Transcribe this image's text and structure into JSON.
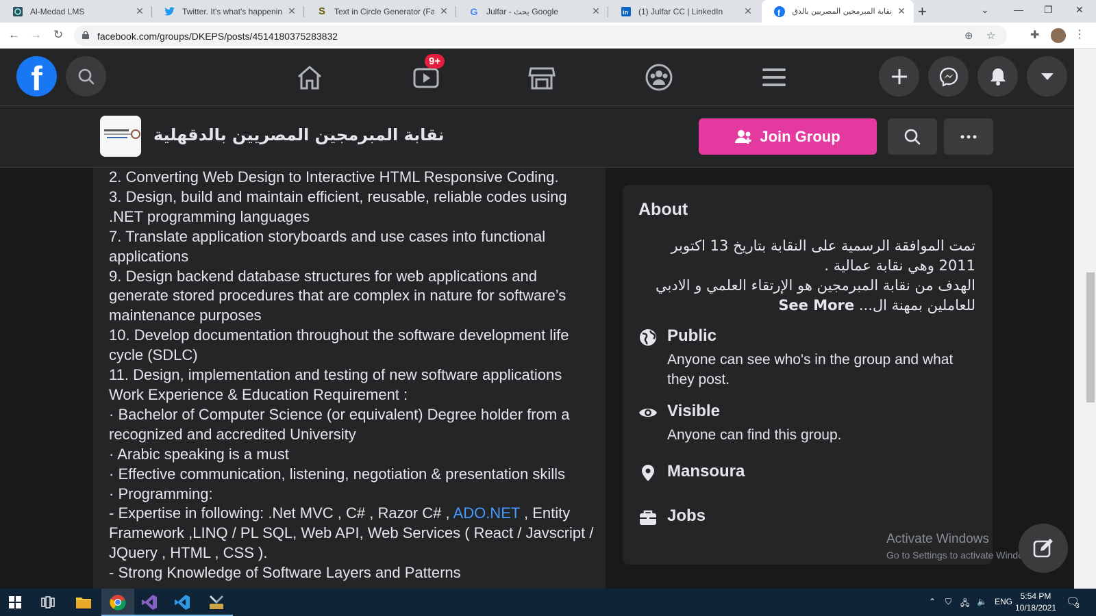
{
  "browser": {
    "tabs": [
      {
        "title": "Al-Medad LMS",
        "favicon": "lms-icon"
      },
      {
        "title": "Twitter. It's what's happening",
        "favicon": "twitter-icon"
      },
      {
        "title": "Text in Circle Generator (Fami",
        "favicon": "s-icon"
      },
      {
        "title": "Julfar - بحث Google",
        "favicon": "google-icon"
      },
      {
        "title": "(1) Julfar CC | LinkedIn",
        "favicon": "linkedin-icon"
      },
      {
        "title": "نقابة المبرمجين المصريين بالدق",
        "favicon": "facebook-icon",
        "active": true
      }
    ],
    "url": "facebook.com/groups/DKEPS/posts/4514180375283832"
  },
  "fbnav": {
    "watch_badge": "9+"
  },
  "group": {
    "name": "نقابة المبرمجين المصريين بالدقهلية",
    "join_label": "Join Group"
  },
  "post": {
    "lines": [
      "2. Converting Web Design to Interactive HTML Responsive Coding.",
      "3. Design, build and maintain efficient, reusable, reliable codes using",
      ".NET programming languages",
      "7. Translate application storyboards and use cases into functional",
      "applications",
      "9. Design backend database structures for web applications and",
      "generate stored procedures that are complex in nature for software’s",
      "maintenance purposes",
      "10. Develop documentation throughout the software development life",
      "cycle (SDLC)",
      "11. Design, implementation and testing of new software applications",
      "Work Experience & Education Requirement :",
      "· Bachelor of Computer Science (or equivalent) Degree holder from a",
      "recognized and accredited University",
      "· Arabic speaking is a must",
      "· Effective communication, listening, negotiation & presentation skills",
      "· Programming:"
    ],
    "expertise_prefix": "- Expertise in following: .Net MVC , C# , Razor C# , ",
    "expertise_link": "ADO.NET",
    "expertise_suffix": " , Entity",
    "lines_after": [
      "Framework ,LINQ / PL SQL, Web API, Web Services ( React / Javscript /",
      "JQuery , HTML , CSS ).",
      "- Strong Knowledge of Software Layers and Patterns"
    ]
  },
  "about": {
    "title": "About",
    "desc_line1": "تمت الموافقة الرسمية على النقابة بتاريخ 13 اكتوبر",
    "desc_line2": "2011 وهي نقابة عمالية .",
    "desc_line3": "الهدف من نقابة المبرمجين هو الإرتقاء العلمي و الادبي",
    "desc_line4": "للعاملين بمهنة ال...",
    "see_more": "See More",
    "public_title": "Public",
    "public_desc": "Anyone can see who's in the group and what they post.",
    "visible_title": "Visible",
    "visible_desc": "Anyone can find this group.",
    "location": "Mansoura",
    "jobs": "Jobs"
  },
  "watermark": {
    "line1": "Activate Windows",
    "line2": "Go to Settings to activate Windows."
  },
  "taskbar": {
    "lang": "ENG",
    "time": "5:54 PM",
    "date": "10/18/2021",
    "notif_count": "3"
  }
}
